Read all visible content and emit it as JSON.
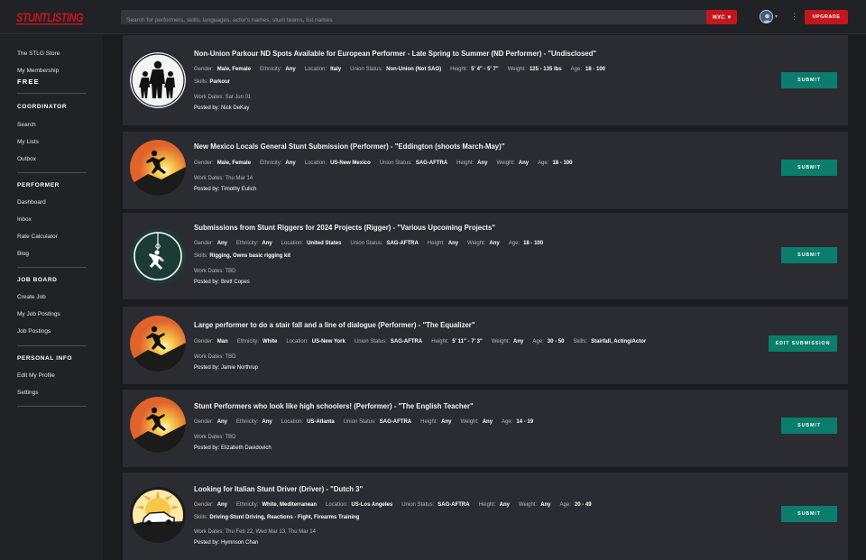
{
  "header": {
    "logo_text": "STUNTLISTING",
    "search_placeholder": "Search for performers, skills, languages, actor's names, stunt teams, list names",
    "city": "NYC",
    "city_caret": "▾",
    "avatar_caret": "▾",
    "kebab": "⋮",
    "upgrade_label": "UPGRADE"
  },
  "sidebar": {
    "store": "The STLG Store",
    "membership": "My Membership",
    "membership_tier": "FREE",
    "coordinator_heading": "COORDINATOR",
    "search": "Search",
    "my_lists": "My Lists",
    "outbox": "Outbox",
    "performer_heading": "PERFORMER",
    "dashboard": "Dashboard",
    "inbox": "Inbox",
    "rate_calculator": "Rate Calculator",
    "blog": "Blog",
    "job_board_heading": "JOB BOARD",
    "create_job": "Create Job",
    "my_job_postings": "My Job Postings",
    "job_postings": "Job Postings",
    "personal_info_heading": "PERSONAL INFO",
    "edit_my_profile": "Edit My Profile",
    "settings": "Settings"
  },
  "labels": {
    "gender": "Gender:",
    "ethnicity": "Ethnicity:",
    "location": "Location:",
    "union_status": "Union Status:",
    "height": "Height:",
    "weight": "Weight:",
    "age": "Age:",
    "skills": "Skills:",
    "work_dates": "Work Dates:",
    "posted_by": "Posted by:"
  },
  "jobs": [
    {
      "title": "Non-Union Parkour ND Spots Available for European Performer - Late Spring to Summer (ND Performer) - \"Undisclosed\"",
      "gender": "Male, Female",
      "ethnicity": "Any",
      "location": "Italy",
      "union": "Non-Union (Not SAG)",
      "height": "5' 4\" - 5' 7\"",
      "weight": "125 - 135 lbs",
      "age": "18 - 100",
      "skills": "Parkour",
      "work_dates": "Sat Jun 01",
      "posted_by": "Nick DeKay",
      "action": "SUBMIT",
      "icon": "silhouettes-icon"
    },
    {
      "title": "New Mexico Locals General Stunt Submission (Performer) - \"Eddington (shoots March-May)\"",
      "gender": "Male, Female",
      "ethnicity": "Any",
      "location": "US-New Mexico",
      "union": "SAG-AFTRA",
      "height": "Any",
      "weight": "Any",
      "age": "18 - 100",
      "work_dates": "Thu Mar 14",
      "posted_by": "Timothy Eulich",
      "action": "SUBMIT",
      "icon": "stunt-jump-icon"
    },
    {
      "title": "Submissions from Stunt Riggers for 2024 Projects (Rigger) - \"Various Upcoming Projects\"",
      "gender": "Any",
      "ethnicity": "Any",
      "location": "United States",
      "union": "SAG-AFTRA",
      "height": "Any",
      "weight": "Any",
      "age": "18 - 100",
      "skills": "Rigging, Owns basic rigging kit",
      "work_dates": "TBD",
      "posted_by": "Brett Copes",
      "action": "SUBMIT",
      "icon": "rigger-icon"
    },
    {
      "title": "Large performer to do a stair fall and a line of dialogue (Performer) - \"The Equalizer\"",
      "gender": "Man",
      "ethnicity": "White",
      "location": "US-New York",
      "union": "SAG-AFTRA",
      "height": "5' 11\" - 7' 3\"",
      "weight": "Any",
      "age": "30 - 50",
      "skills_inline": "Stairfall, Acting/Actor",
      "work_dates": "TBD",
      "posted_by": "Jamie Northrup",
      "action": "EDIT SUBMISSION",
      "icon": "stunt-jump-icon"
    },
    {
      "title": "Stunt Performers who look like high schoolers! (Performer) - \"The English Teacher\"",
      "gender": "Any",
      "ethnicity": "Any",
      "location": "US-Atlanta",
      "union": "SAG-AFTRA",
      "height": "Any",
      "weight": "Any",
      "age": "14 - 19",
      "work_dates": "TBD",
      "posted_by": "Elizabeth Davidovich",
      "action": "SUBMIT",
      "icon": "stunt-jump-icon"
    },
    {
      "title": "Looking for Italian Stunt Driver (Driver) - \"Dutch 3\"",
      "gender": "Any",
      "ethnicity": "White, Mediterranean",
      "location": "US-Los Angeles",
      "union": "SAG-AFTRA",
      "height": "Any",
      "weight": "Any",
      "age": "20 - 49",
      "skills": "Driving-Stunt Driving, Reactions - Fight, Firearms Training",
      "work_dates": "Thu Feb 22, Wed Mar 13, Thu Mar 14",
      "posted_by": "Hymnson Chan",
      "action": "SUBMIT",
      "icon": "car-icon"
    }
  ]
}
